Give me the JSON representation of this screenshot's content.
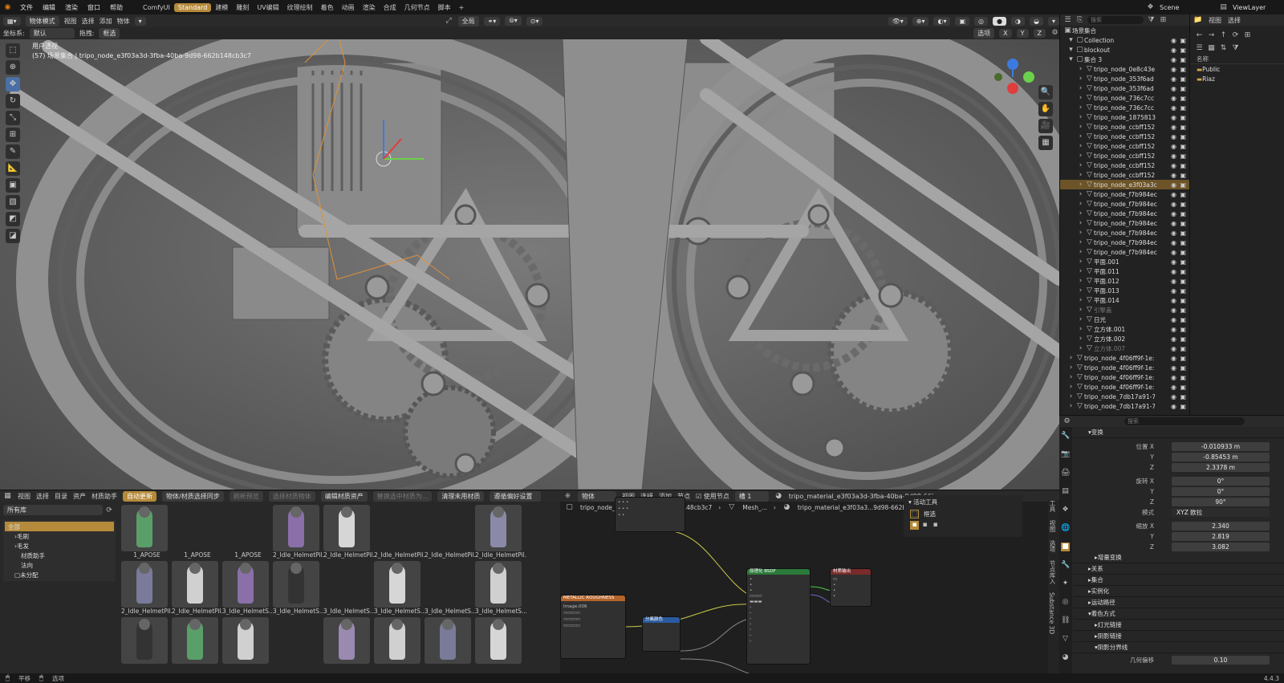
{
  "topbar": {
    "menus": [
      "文件",
      "编辑",
      "渲染",
      "窗口",
      "帮助"
    ],
    "workspaces": [
      "ComfyUI",
      "Standard",
      "建模",
      "雕刻",
      "UV编辑",
      "纹理绘制",
      "着色",
      "动画",
      "渲染",
      "合成",
      "几何节点",
      "脚本"
    ],
    "active_workspace": "Standard",
    "add_tab": "+",
    "scene_label": "Scene",
    "viewlayer_label": "ViewLayer"
  },
  "viewport": {
    "mode": "物体模式",
    "menus": [
      "视图",
      "选择",
      "添加",
      "物体"
    ],
    "transform_global": "全局",
    "coord_label": "坐标系:",
    "coord_value": "默认",
    "drag_label": "拖拽:",
    "drag_value": "框选",
    "select_label": "选项",
    "axes": [
      "X",
      "Y",
      "Z"
    ],
    "view_title": "用户透视",
    "view_subtitle": "(57) 场景集合 | tripo_node_e3f03a3d-3fba-40ba-9d98-662b148cb3c7"
  },
  "outliner": {
    "search_placeholder": "搜索",
    "root": "场景集合",
    "items": [
      {
        "name": "Collection",
        "level": 1,
        "type": "coll"
      },
      {
        "name": "blockout",
        "level": 1,
        "type": "coll"
      },
      {
        "name": "集合 3",
        "level": 1,
        "type": "coll"
      },
      {
        "name": "tripo_node_0e8c43e",
        "level": 2
      },
      {
        "name": "tripo_node_353f6ad",
        "level": 2
      },
      {
        "name": "tripo_node_353f6ad",
        "level": 2
      },
      {
        "name": "tripo_node_736c7cc",
        "level": 2
      },
      {
        "name": "tripo_node_736c7cc",
        "level": 2
      },
      {
        "name": "tripo_node_1875813",
        "level": 2
      },
      {
        "name": "tripo_node_ccbff152",
        "level": 2
      },
      {
        "name": "tripo_node_ccbff152",
        "level": 2
      },
      {
        "name": "tripo_node_ccbff152",
        "level": 2
      },
      {
        "name": "tripo_node_ccbff152",
        "level": 2
      },
      {
        "name": "tripo_node_ccbff152",
        "level": 2
      },
      {
        "name": "tripo_node_ccbff152",
        "level": 2
      },
      {
        "name": "tripo_node_e3f03a3c",
        "level": 2,
        "selected": true
      },
      {
        "name": "tripo_node_f7b984ec",
        "level": 2
      },
      {
        "name": "tripo_node_f7b984ec",
        "level": 2
      },
      {
        "name": "tripo_node_f7b984ec",
        "level": 2
      },
      {
        "name": "tripo_node_f7b984ec",
        "level": 2
      },
      {
        "name": "tripo_node_f7b984ec",
        "level": 2
      },
      {
        "name": "tripo_node_f7b984ec",
        "level": 2
      },
      {
        "name": "tripo_node_f7b984ec",
        "level": 2
      },
      {
        "name": "平面.001",
        "level": 2
      },
      {
        "name": "平面.011",
        "level": 2
      },
      {
        "name": "平面.012",
        "level": 2
      },
      {
        "name": "平面.013",
        "level": 2
      },
      {
        "name": "平面.014",
        "level": 2
      },
      {
        "name": "引擎盖",
        "level": 2,
        "dim": true
      },
      {
        "name": "日光",
        "level": 2
      },
      {
        "name": "立方体.001",
        "level": 2
      },
      {
        "name": "立方体.002",
        "level": 2
      },
      {
        "name": "立方体.007",
        "level": 2,
        "dim": true
      },
      {
        "name": "tripo_node_4f06ff9f-1e:",
        "level": 1
      },
      {
        "name": "tripo_node_4f06ff9f-1e:",
        "level": 1
      },
      {
        "name": "tripo_node_4f06ff9f-1e:",
        "level": 1
      },
      {
        "name": "tripo_node_4f06ff9f-1e:",
        "level": 1
      },
      {
        "name": "tripo_node_7db17a91-7",
        "level": 1
      },
      {
        "name": "tripo_node_7db17a91-7",
        "level": 1
      }
    ]
  },
  "filebrowser": {
    "menus": [
      "视图",
      "选择"
    ],
    "name_header": "名称",
    "folders": [
      "Public",
      "Riaz"
    ]
  },
  "properties": {
    "search_placeholder": "搜索",
    "section_transform": "变换",
    "location_label": "位置 X",
    "location": [
      "-0.010933 m",
      "-0.85453 m",
      "2.3378 m"
    ],
    "rotation_label": "旋转 X",
    "rotation": [
      "0°",
      "0°",
      "90°"
    ],
    "mode_label": "模式",
    "mode_value": "XYZ 欧拉",
    "scale_label": "缩放 X",
    "scale": [
      "2.340",
      "2.819",
      "3.082"
    ],
    "axis_y": "Y",
    "axis_z": "Z",
    "delta_label": "增量变换",
    "sections": [
      "关系",
      "集合",
      "实例化",
      "运动路径",
      "着色方式"
    ],
    "sub_sections": [
      "灯光链接",
      "阴影链接",
      "阴影分界线"
    ],
    "geo_offset_label": "几何偏移",
    "geo_offset_value": "0.10"
  },
  "assets": {
    "menus": [
      "视图",
      "选择",
      "目录",
      "资产",
      "材质助手"
    ],
    "auto_refresh": "自动更新",
    "sync_label": "物体/材质选择同步",
    "refresh_preview": "刷新预览",
    "select_objects": "选择材质物体",
    "edit_asset": "编辑材质资产",
    "replace_material": "替换选中材质为...",
    "clean_material": "清理未用材质",
    "prefs_label": "遵循偏好设置",
    "library_label": "所有库",
    "tree": [
      "全部",
      "毛刷",
      "毛发",
      "材质助手",
      "法向",
      "未分配"
    ],
    "grid": [
      {
        "label": "1_APOSE",
        "color": "#5a9f6a",
        "has": true
      },
      {
        "label": "1_APOSE",
        "color": "",
        "has": false
      },
      {
        "label": "1_APOSE",
        "color": "",
        "has": false
      },
      {
        "label": "2_Idle_HelmetPil...",
        "color": "#8a6fa8",
        "has": true
      },
      {
        "label": "2_Idle_HelmetPil...",
        "color": "#d6d6d6",
        "has": true
      },
      {
        "label": "2_Idle_HelmetPil...",
        "color": "",
        "has": false
      },
      {
        "label": "2_Idle_HelmetPil...",
        "color": "",
        "has": false
      },
      {
        "label": "2_Idle_HelmetPil...",
        "color": "#8a8aa8",
        "has": true
      },
      {
        "label": "2_Idle_HelmetPil...",
        "color": "#7a7a9a",
        "has": true
      },
      {
        "label": "2_Idle_HelmetPil...",
        "color": "#d0d0d0",
        "has": true
      },
      {
        "label": "3_Idle_HelmetS...",
        "color": "#8a6fa8",
        "has": true
      },
      {
        "label": "3_Idle_HelmetS...",
        "color": "#333",
        "has": true
      },
      {
        "label": "3_Idle_HelmetS...",
        "color": "",
        "has": false
      },
      {
        "label": "3_Idle_HelmetS...",
        "color": "#d6d6d6",
        "has": true
      },
      {
        "label": "3_Idle_HelmetS...",
        "color": "",
        "has": false
      },
      {
        "label": "3_Idle_HelmetS...",
        "color": "#d0d0d0",
        "has": true
      },
      {
        "label": "",
        "color": "#333",
        "has": true
      },
      {
        "label": "",
        "color": "#5a9f6a",
        "has": true
      },
      {
        "label": "",
        "color": "#d0d0d0",
        "has": true
      },
      {
        "label": "",
        "color": "",
        "has": false
      },
      {
        "label": "",
        "color": "#9a8ab0",
        "has": true
      },
      {
        "label": "",
        "color": "#d0d0d0",
        "has": true
      },
      {
        "label": "",
        "color": "#7a7a9a",
        "has": true
      },
      {
        "label": "",
        "color": "#d6d6d6",
        "has": true
      }
    ]
  },
  "nodes": {
    "menus": [
      "物体",
      "视图",
      "选择",
      "添加",
      "节点"
    ],
    "use_nodes": "使用节点",
    "slot": "槽 1",
    "material_name": "tripo_material_e3f03a3d-3fba-40ba-9d98-662b148...",
    "breadcrumb_obj": "tripo_node_e3f03a3d...9d98-662b148cb3c7",
    "breadcrumb_mesh": "Mesh_...",
    "breadcrumb_mat": "tripo_material_e3f03a3...9d98-662b148cb3c7",
    "active_tool": "活动工具",
    "box_select": "框选",
    "side_tabs": [
      "工具",
      "视图",
      "选项",
      "节点库入",
      "Substance 3D"
    ],
    "node_metallic": "METALLIC ROUGHNESS",
    "node_bsdf": "原理化 BSDF",
    "node_out": "材质输出",
    "node_sep": "分离颜色",
    "node_img": "Image.006"
  },
  "status": {
    "left1": "平移",
    "left2": "选项",
    "version": "4.4.3"
  }
}
